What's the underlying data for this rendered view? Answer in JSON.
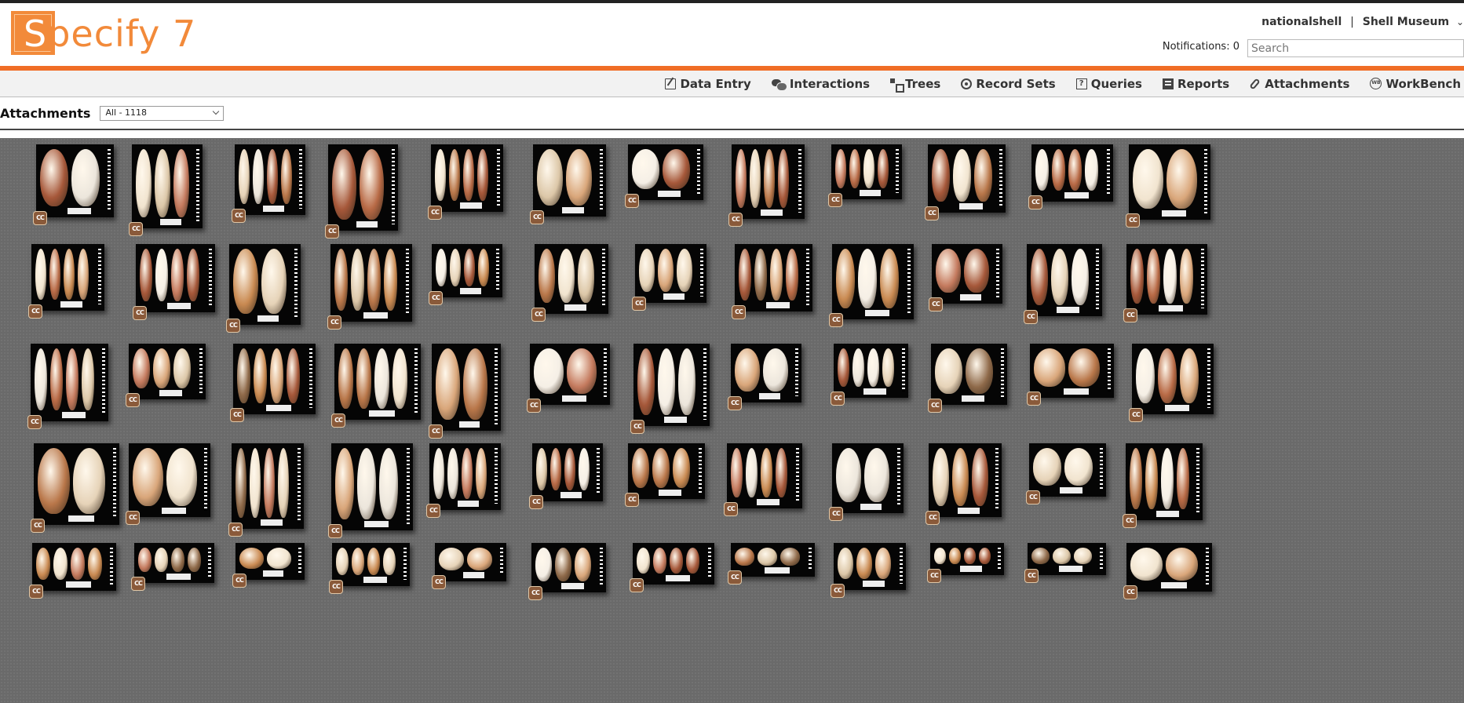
{
  "app": {
    "logo_initial": "S",
    "logo_rest": "pecify 7"
  },
  "user": {
    "name": "nationalshell",
    "separator": "|",
    "collection": "Shell Museum"
  },
  "notifications_label": "Notifications: 0",
  "search": {
    "placeholder": "Search"
  },
  "nav": [
    {
      "label": "Data Entry",
      "icon": "edit-icon"
    },
    {
      "label": "Interactions",
      "icon": "chat-icon"
    },
    {
      "label": "Trees",
      "icon": "tree-icon"
    },
    {
      "label": "Record Sets",
      "icon": "recordset-icon"
    },
    {
      "label": "Queries",
      "icon": "query-icon"
    },
    {
      "label": "Reports",
      "icon": "report-icon"
    },
    {
      "label": "Attachments",
      "icon": "paperclip-icon"
    },
    {
      "label": "WorkBench",
      "icon": "workbench-icon"
    }
  ],
  "page": {
    "title": "Attachments",
    "filter_value": "All - 1118"
  },
  "license_badge": "CC",
  "gallery": {
    "rows": 5,
    "columns": 12,
    "shell_colors": [
      "#c98a52",
      "#e6d3b8",
      "#b9774a",
      "#f1e4cf",
      "#d9a67a",
      "#a6583a",
      "#ece6dc",
      "#c47a5e",
      "#8f6a4a",
      "#dcc7a8",
      "#f5efe6",
      "#b86a46"
    ]
  }
}
